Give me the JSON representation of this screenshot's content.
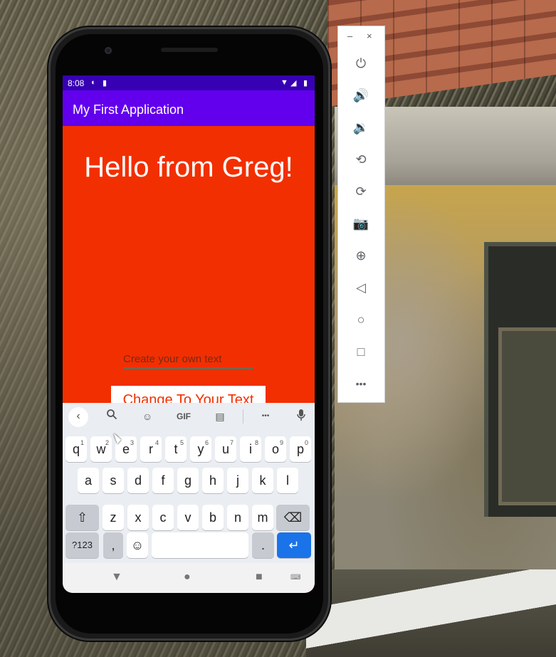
{
  "status_bar": {
    "time": "8:08"
  },
  "app": {
    "title": "My First Application",
    "hello_text": "Hello from Greg!",
    "input_placeholder": "Create your own text",
    "button_label": "Change To Your Text"
  },
  "keyboard": {
    "toolbar": {
      "gif_label": "GIF",
      "more_label": "•••"
    },
    "row1": [
      {
        "label": "q",
        "hint": "1"
      },
      {
        "label": "w",
        "hint": "2"
      },
      {
        "label": "e",
        "hint": "3"
      },
      {
        "label": "r",
        "hint": "4"
      },
      {
        "label": "t",
        "hint": "5"
      },
      {
        "label": "y",
        "hint": "6"
      },
      {
        "label": "u",
        "hint": "7"
      },
      {
        "label": "i",
        "hint": "8"
      },
      {
        "label": "o",
        "hint": "9"
      },
      {
        "label": "p",
        "hint": "0"
      }
    ],
    "row2": [
      "a",
      "s",
      "d",
      "f",
      "g",
      "h",
      "j",
      "k",
      "l"
    ],
    "row3": [
      "z",
      "x",
      "c",
      "v",
      "b",
      "n",
      "m"
    ],
    "symbols_label": "?123",
    "comma_label": ",",
    "period_label": "."
  },
  "colors": {
    "app_background": "#f22f00",
    "app_bar": "#6200ee",
    "status_bar": "#3700b3",
    "enter_key": "#1a73e8"
  },
  "icons": {
    "emulator_toolbar": [
      "power-icon",
      "volume-up-icon",
      "volume-down-icon",
      "rotate-left-icon",
      "rotate-right-icon",
      "camera-icon",
      "zoom-icon",
      "back-icon",
      "home-icon",
      "overview-icon",
      "more-icon"
    ]
  }
}
